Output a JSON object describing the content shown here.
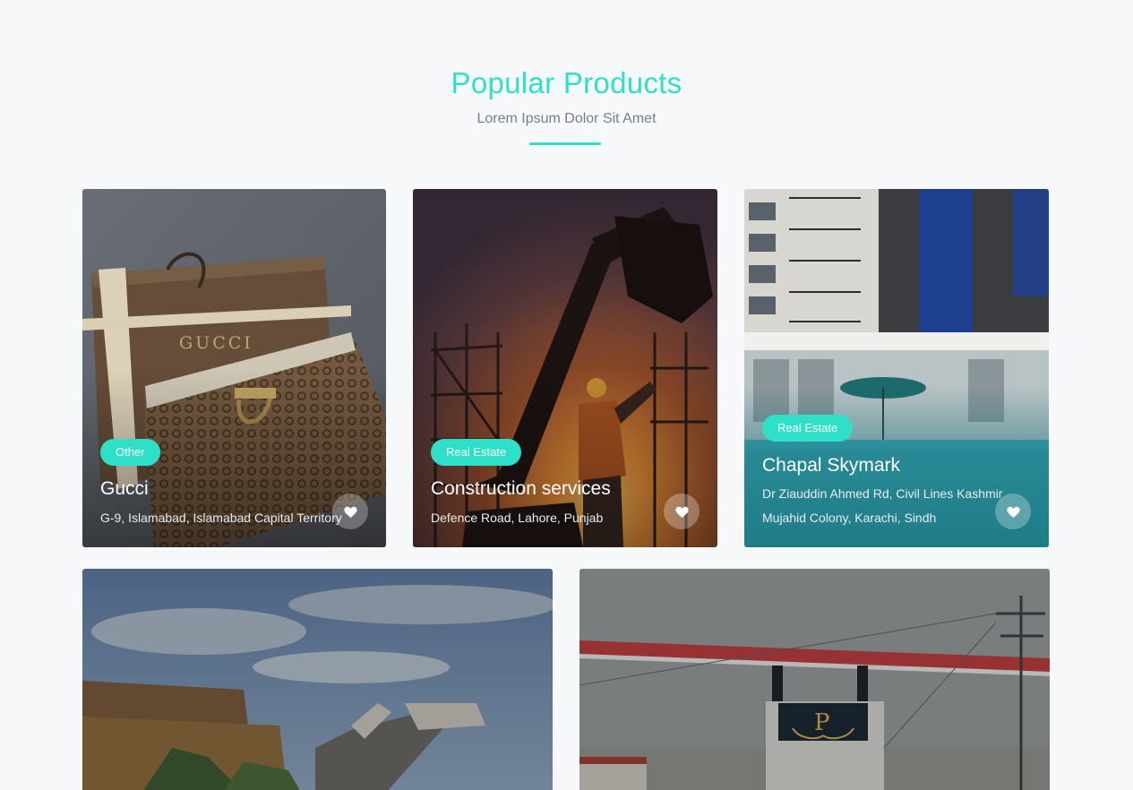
{
  "section": {
    "title": "Popular Products",
    "subtitle": "Lorem Ipsum Dolor Sit Amet",
    "accent_color": "#2ee0c8"
  },
  "cards": [
    {
      "category": "Other",
      "title": "Gucci",
      "lines": [
        "G-9, Islamabad, Islamabad Capital Territory"
      ],
      "icon": "heart-icon",
      "image": "gucci-bag-photo"
    },
    {
      "category": "Real Estate",
      "title": "Construction services",
      "lines": [
        "Defence Road, Lahore, Punjab"
      ],
      "icon": "heart-icon",
      "image": "excavator-sunset-photo"
    },
    {
      "category": "Real Estate",
      "title": "Chapal Skymark",
      "lines": [
        "Dr Ziauddin Ahmed Rd, Civil Lines Kashmir",
        "Mujahid Colony, Karachi, Sindh"
      ],
      "icon": "heart-icon",
      "image": "apartment-building-photo"
    },
    {
      "image": "building-sky-photo"
    },
    {
      "image": "gateway-entrance-photo"
    }
  ]
}
